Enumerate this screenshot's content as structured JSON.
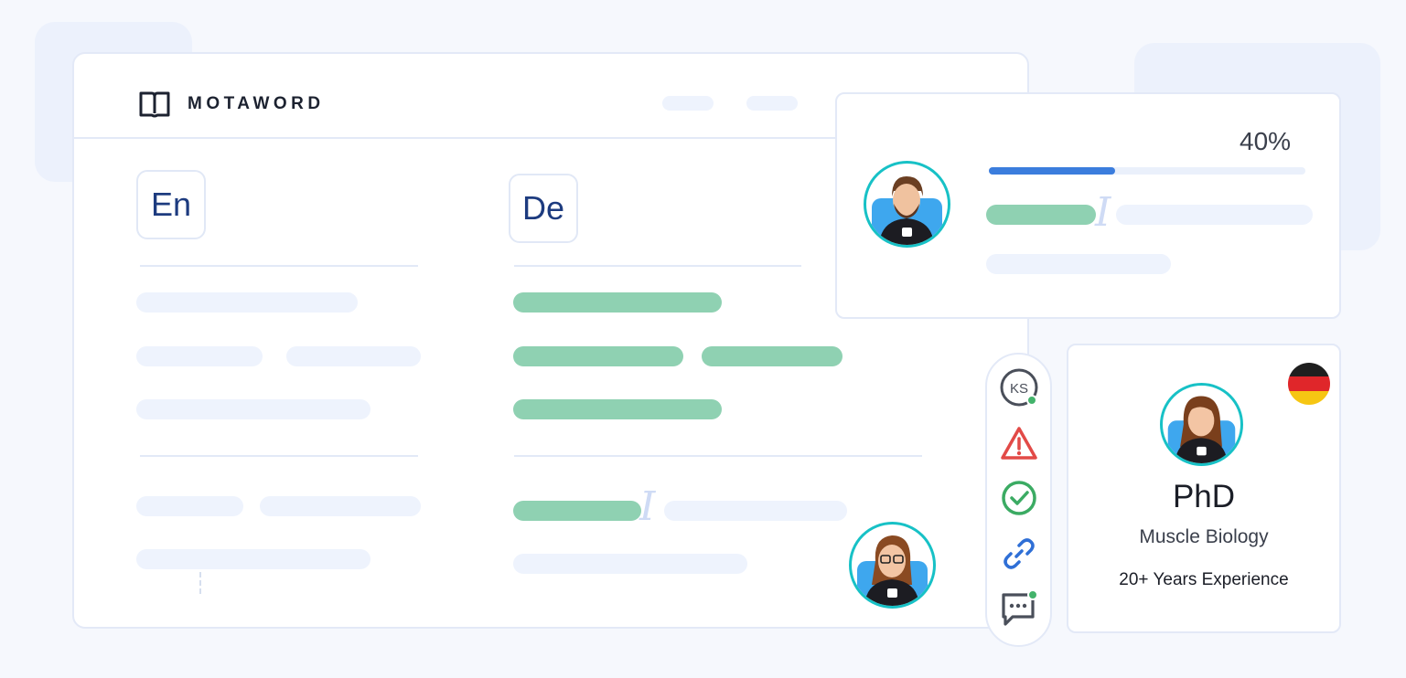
{
  "brand": {
    "name": "MOTAWORD",
    "logo_icon": "open-book-icon"
  },
  "editor": {
    "source_lang": "En",
    "target_lang": "De"
  },
  "progress": {
    "percent_label": "40%",
    "value": 0.4,
    "bar_color": "#3b7ddd"
  },
  "toolbar": {
    "user_initials": "KS",
    "icons": [
      "user-initials-icon",
      "warning-icon",
      "check-circle-icon",
      "link-icon",
      "chat-icon"
    ],
    "status_color": "#43b36b"
  },
  "profile": {
    "degree": "PhD",
    "field": "Muscle Biology",
    "experience": "20+ Years Experience",
    "flag": "germany-flag"
  },
  "colors": {
    "accent": "#17c1c6",
    "green_text": "#8fd1b2",
    "placeholder": "#eef3fd",
    "brand_dark": "#1d3b7f"
  }
}
